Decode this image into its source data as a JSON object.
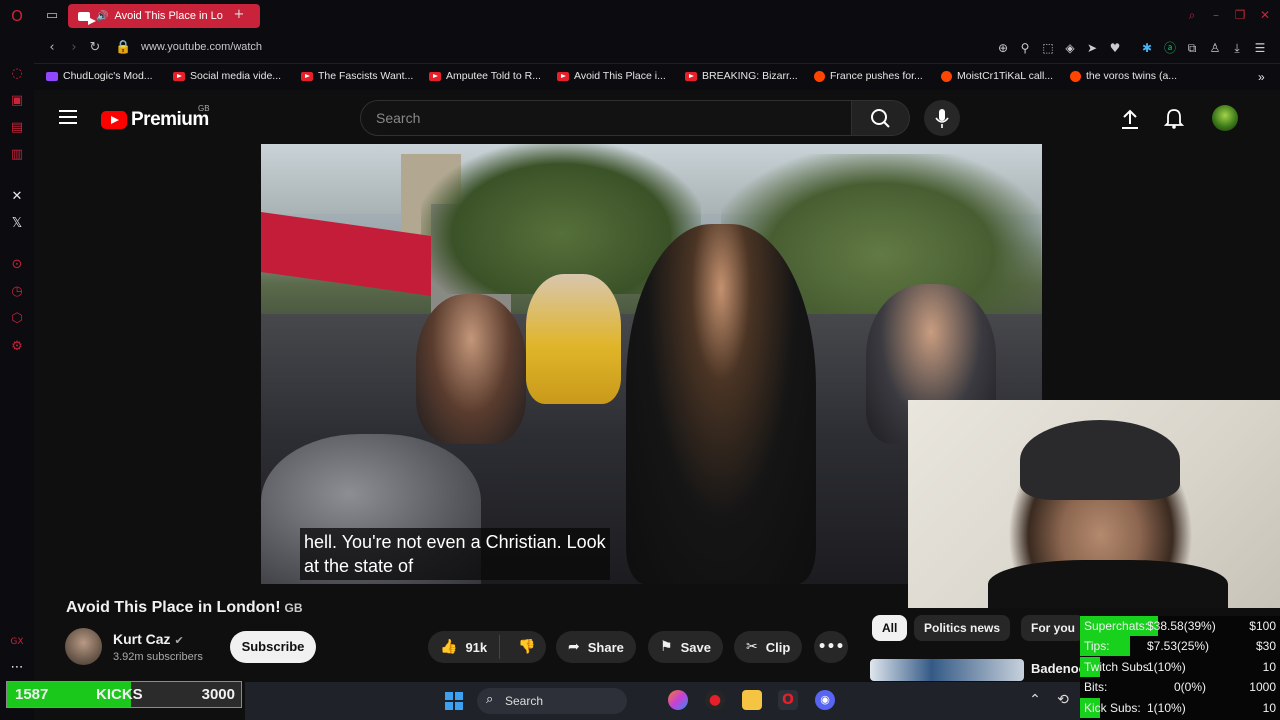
{
  "browser": {
    "tab_title": "Avoid This Place in Lo",
    "url": "www.youtube.com/watch",
    "new_tab_icon": "plus-icon"
  },
  "bookmarks": [
    {
      "label": "ChudLogic's Mod...",
      "icon": "twitch"
    },
    {
      "label": "Social media vide...",
      "icon": "youtube"
    },
    {
      "label": "The Fascists Want...",
      "icon": "youtube"
    },
    {
      "label": "Amputee Told to R...",
      "icon": "youtube"
    },
    {
      "label": "Avoid This Place i...",
      "icon": "youtube"
    },
    {
      "label": "BREAKING: Bizarr...",
      "icon": "youtube"
    },
    {
      "label": "France pushes for...",
      "icon": "reddit"
    },
    {
      "label": "MoistCr1TiKaL call...",
      "icon": "reddit"
    },
    {
      "label": "the voros twins (a...",
      "icon": "reddit"
    }
  ],
  "youtube": {
    "logo_text": "Premium",
    "region": "GB",
    "search_placeholder": "Search"
  },
  "video": {
    "caption_line1": "hell. You're not even a Christian. Look",
    "caption_line2": "at the state of",
    "title": "Avoid This Place in London!",
    "title_suffix": "GB",
    "channel": "Kurt Caz",
    "subscribers": "3.92m subscribers",
    "subscribe_label": "Subscribe",
    "likes": "91k",
    "share_label": "Share",
    "save_label": "Save",
    "clip_label": "Clip"
  },
  "chips": [
    "All",
    "Politics news",
    "For you"
  ],
  "recommendation_partial": "Badenoc",
  "stats": [
    {
      "label": "Superchats:",
      "value": "$38.58(39%)",
      "goal": "$100",
      "fill": 0.39
    },
    {
      "label": "Tips:",
      "value": "$7.53(25%)",
      "goal": "$30",
      "fill": 0.25
    },
    {
      "label": "Twitch Subs:",
      "value": "1(10%)",
      "goal": "10",
      "fill": 0.1
    },
    {
      "label": "Bits:",
      "value": "0(0%)",
      "goal": "1000",
      "fill": 0.0
    },
    {
      "label": "Kick Subs:",
      "value": "1(10%)",
      "goal": "10",
      "fill": 0.1
    }
  ],
  "kicks": {
    "current": "1587",
    "label": "KICKS",
    "goal": "3000",
    "fill": 0.529
  },
  "taskbar": {
    "search_label": "Search"
  },
  "colors": {
    "accent": "#c8233a",
    "yt_red": "#ff0000",
    "stat_green": "#18d11c"
  }
}
